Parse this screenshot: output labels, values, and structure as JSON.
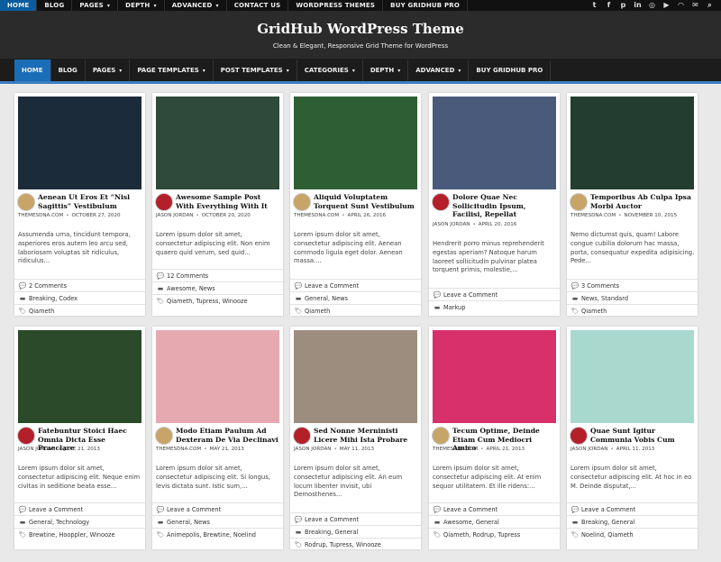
{
  "topbar": {
    "items": [
      "HOME",
      "BLOG",
      "PAGES",
      "DEPTH",
      "ADVANCED",
      "CONTACT US",
      "WORDPRESS THEMES",
      "BUY GRIDHUB PRO"
    ],
    "social_icons": [
      "twitter-icon",
      "facebook-icon",
      "pinterest-icon",
      "linkedin-icon",
      "instagram-icon",
      "youtube-icon",
      "rss-icon",
      "email-icon",
      "search-icon"
    ]
  },
  "header": {
    "title": "GridHub WordPress Theme",
    "description": "Clean & Elegant, Responsive Grid Theme for WordPress"
  },
  "mainnav": {
    "items": [
      "HOME",
      "BLOG",
      "PAGES",
      "PAGE TEMPLATES",
      "POST TEMPLATES",
      "CATEGORIES",
      "DEPTH",
      "ADVANCED",
      "BUY GRIDHUB PRO"
    ]
  },
  "posts": [
    {
      "title": "Aenean Ut Eros Et “Nisl Sagittis” Vestibulum",
      "author": "THEMESDNA.COM",
      "date": "OCTOBER 27, 2020",
      "excerpt": "Assumenda urna, tincidunt tempora, asperiores eros autem leo arcu sed, laboriosam voluptas sit ridiculus, ridiculus...",
      "comments": "2 Comments",
      "categories": "Breaking, Codex",
      "tags": "Qiameth",
      "thumb_color": "#1c2b3a",
      "avatar_color": "#c7a468"
    },
    {
      "title": "Awesome Sample Post With Everything With It",
      "author": "JASON JORDAN",
      "date": "OCTOBER 20, 2020",
      "excerpt": "Lorem ipsum dolor sit amet, consectetur adipiscing elit. Non enim quaero quid verum, sed quid...",
      "comments": "12 Comments",
      "categories": "Awesome, News",
      "tags": "Qiameth, Tupress, Winooze",
      "thumb_color": "#2f4a3a",
      "avatar_color": "#b3202a"
    },
    {
      "title": "Aliquid Voluptatem Torquent Sunt Vestibulum",
      "author": "THEMESDNA.COM",
      "date": "APRIL 26, 2016",
      "excerpt": "Lorem ipsum dolor sit amet, consectetur adipiscing elit. Aenean commodo ligula eget dolor. Aenean massa....",
      "comments": "Leave a Comment",
      "categories": "General, News",
      "tags": "Qiameth",
      "thumb_color": "#2e5f33",
      "avatar_color": "#c7a468"
    },
    {
      "title": "Dolore Quae Nec Sollicitudin Ipsum, Facilisi, Repellat",
      "author": "JASON JORDAN",
      "date": "APRIL 20, 2016",
      "excerpt": "Hendrerit porro minus reprehenderit egestas aperiam? Natoque harum laoreet sollicitudin pulvinar platea torquent primis, molestie,...",
      "comments": "Leave a Comment",
      "categories": "Markup",
      "tags": "",
      "thumb_color": "#4a5a7a",
      "avatar_color": "#b3202a"
    },
    {
      "title": "Temporibus Ab Culpa Ipsa Morbi Auctor",
      "author": "THEMESDNA.COM",
      "date": "NOVEMBER 10, 2015",
      "excerpt": "Nemo dictumst quis, quam! Labore congue cubilia dolorum hac massa, porta, consequatur expedita adipisicing. Pede...",
      "comments": "3 Comments",
      "categories": "News, Standard",
      "tags": "Qiameth",
      "thumb_color": "#233d30",
      "avatar_color": "#c7a468"
    },
    {
      "title": "Fatebuntur Stoici Haec Omnia Dicta Esse Praeclare",
      "author": "JASON JORDAN",
      "date": "JUNE 21, 2013",
      "excerpt": "Lorem ipsum dolor sit amet, consectetur adipiscing elit. Neque enim civitas in seditione beata esse...",
      "comments": "Leave a Comment",
      "categories": "General, Technology",
      "tags": "Brewtine, Hooppler, Winooze",
      "thumb_color": "#2a4a2a",
      "avatar_color": "#b3202a"
    },
    {
      "title": "Modo Etiam Paulum Ad Dexteram De Via Declinavi",
      "author": "THEMESDNA.COM",
      "date": "MAY 21, 2013",
      "excerpt": "Lorem ipsum dolor sit amet, consectetur adipiscing elit. Si longus, levis dictata sunt. Istic sum,...",
      "comments": "Leave a Comment",
      "categories": "General, News",
      "tags": "Animepolis, Brewtine, Noelind",
      "thumb_color": "#e7a9b0",
      "avatar_color": "#c7a468"
    },
    {
      "title": "Sed Nonne Merninisti Licere Mihi Ista Probare",
      "author": "JASON JORDAN",
      "date": "MAY 11, 2013",
      "excerpt": "Lorem ipsum dolor sit amet, consectetur adipiscing elit. An eum locum libenter invisit, ubi Demosthenes...",
      "comments": "Leave a Comment",
      "categories": "Breaking, General",
      "tags": "Rodrup, Tupress, Winooze",
      "thumb_color": "#9d8d7e",
      "avatar_color": "#b3202a"
    },
    {
      "title": "Tecum Optime, Deinde Etiam Cum Mediocri Amico",
      "author": "THEMESDNA.COM",
      "date": "APRIL 21, 2013",
      "excerpt": "Lorem ipsum dolor sit amet, consectetur adipiscing elit. At enim sequor utilitatem. Et ille ridens:...",
      "comments": "Leave a Comment",
      "categories": "Awesome, General",
      "tags": "Qiameth, Rodrup, Tupress",
      "thumb_color": "#d8306a",
      "avatar_color": "#c7a468"
    },
    {
      "title": "Quae Sunt Igitur Communia Vobis Cum",
      "author": "JASON JORDAN",
      "date": "APRIL 11, 2013",
      "excerpt": "Lorem ipsum dolor sit amet, consectetur adipiscing elit. At hoc in eo M. Deinde disputat,...",
      "comments": "Leave a Comment",
      "categories": "Breaking, General",
      "tags": "Noelind, Qiameth",
      "thumb_color": "#a9d8cf",
      "avatar_color": "#b3202a"
    }
  ]
}
